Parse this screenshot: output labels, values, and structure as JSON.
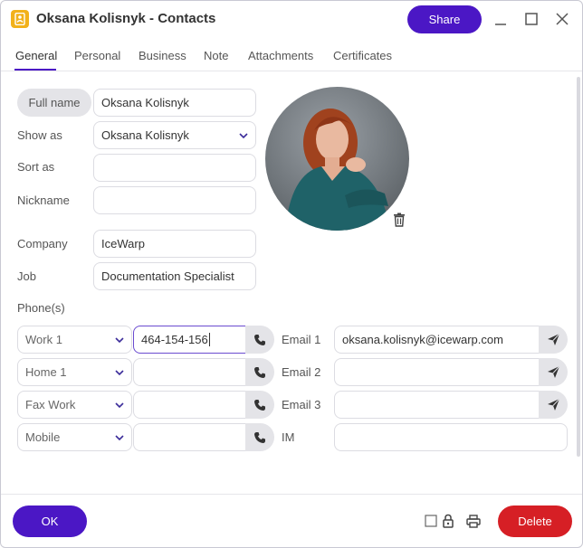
{
  "window": {
    "title": "Oksana Kolisnyk - Contacts",
    "share_label": "Share",
    "accent": "#4b17c5",
    "danger": "#d61f25"
  },
  "tabs": [
    {
      "label": "General",
      "active": true
    },
    {
      "label": "Personal"
    },
    {
      "label": "Business"
    },
    {
      "label": "Note"
    },
    {
      "label": "Attachments"
    },
    {
      "label": "Certificates"
    }
  ],
  "form": {
    "full_name_label": "Full name",
    "full_name_value": "Oksana Kolisnyk",
    "show_as_label": "Show as",
    "show_as_value": "Oksana Kolisnyk",
    "sort_as_label": "Sort as",
    "sort_as_value": "",
    "nickname_label": "Nickname",
    "nickname_value": "",
    "company_label": "Company",
    "company_value": "IceWarp",
    "job_label": "Job",
    "job_value": "Documentation Specialist",
    "phones_label": "Phone(s)",
    "phones": [
      {
        "type": "Work 1",
        "value": "464-154-156"
      },
      {
        "type": "Home 1",
        "value": ""
      },
      {
        "type": "Fax Work",
        "value": ""
      },
      {
        "type": "Mobile",
        "value": ""
      }
    ],
    "emails": [
      {
        "label": "Email 1",
        "value": "oksana.kolisnyk@icewarp.com"
      },
      {
        "label": "Email 2",
        "value": ""
      },
      {
        "label": "Email 3",
        "value": ""
      }
    ],
    "im_label": "IM",
    "im_value": ""
  },
  "footer": {
    "ok_label": "OK",
    "delete_label": "Delete"
  },
  "icons": {
    "app": "contacts-app-icon",
    "minimize": "minimize-icon",
    "maximize": "maximize-icon",
    "close": "close-icon",
    "chevron": "chevron-down-icon",
    "phone": "phone-icon",
    "send": "send-icon",
    "trash": "trash-icon",
    "checkbox": "checkbox-icon",
    "lock": "lock-icon",
    "print": "print-icon"
  }
}
